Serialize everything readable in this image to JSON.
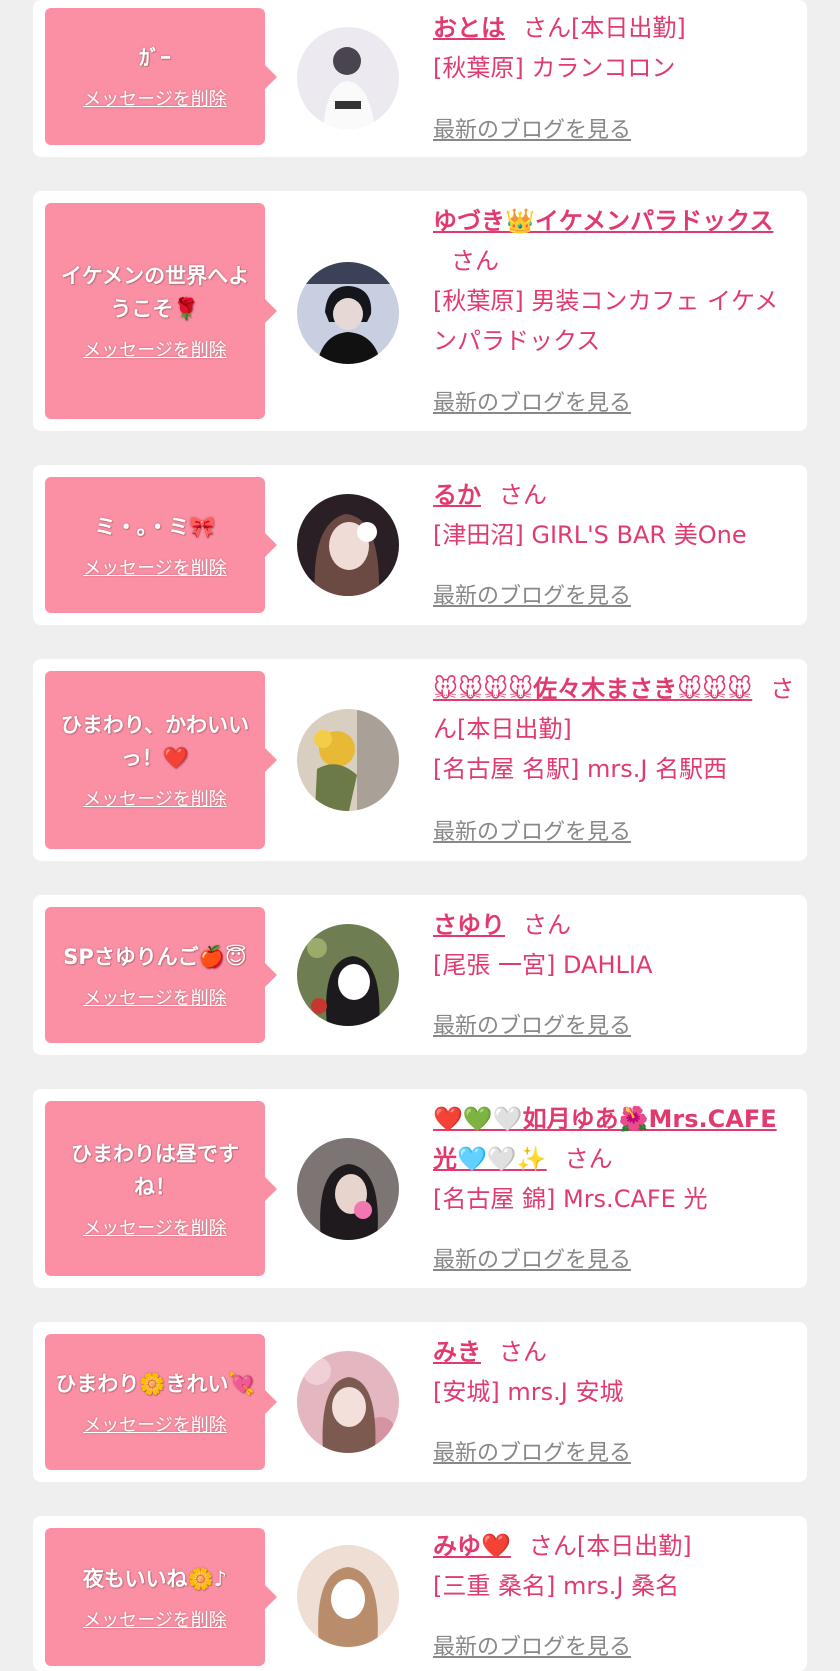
{
  "delete_label": "メッセージを削除",
  "blog_label": "最新のブログを見る",
  "accent_color": "#fb8fa3",
  "text_color": "#e03a6e",
  "entries": [
    {
      "message": "ｶﾞｰ",
      "name": "おとは",
      "suffix": "さん[本日出勤]",
      "shop": "[秋葉原] カランコロン"
    },
    {
      "message": "イケメンの世界へようこそ🌹",
      "name": "ゆづき👑イケメンパラドックス",
      "suffix": "さん",
      "shop": "[秋葉原] 男装コンカフェ イケメンパラドックス"
    },
    {
      "message": "ミ・。・ミ🎀",
      "name": "るか",
      "suffix": "さん",
      "shop": "[津田沼] GIRL'S BAR 美One"
    },
    {
      "message": "ひまわり、かわいいっ！❤️",
      "name": "🐭🐭🐭🐭佐々木まさき🐭🐭🐭",
      "suffix": "さん[本日出勤]",
      "shop": "[名古屋 名駅] mrs.J 名駅西"
    },
    {
      "message": "SPさゆりんご🍎😇",
      "name": "さゆり",
      "suffix": "さん",
      "shop": "[尾張 一宮] DAHLIA"
    },
    {
      "message": "ひまわりは昼ですね！",
      "name": "❤️💚🤍如月ゆあ🌺Mrs.CAFE光🩵🤍✨",
      "suffix": "さん",
      "shop": "[名古屋 錦] Mrs.CAFE 光"
    },
    {
      "message": "ひまわり🌼きれい💘",
      "name": "みき",
      "suffix": "さん",
      "shop": "[安城] mrs.J 安城"
    },
    {
      "message": "夜もいいね🌼♪",
      "name": "みゆ❤️",
      "suffix": "さん[本日出勤]",
      "shop": "[三重 桑名] mrs.J 桑名"
    }
  ]
}
